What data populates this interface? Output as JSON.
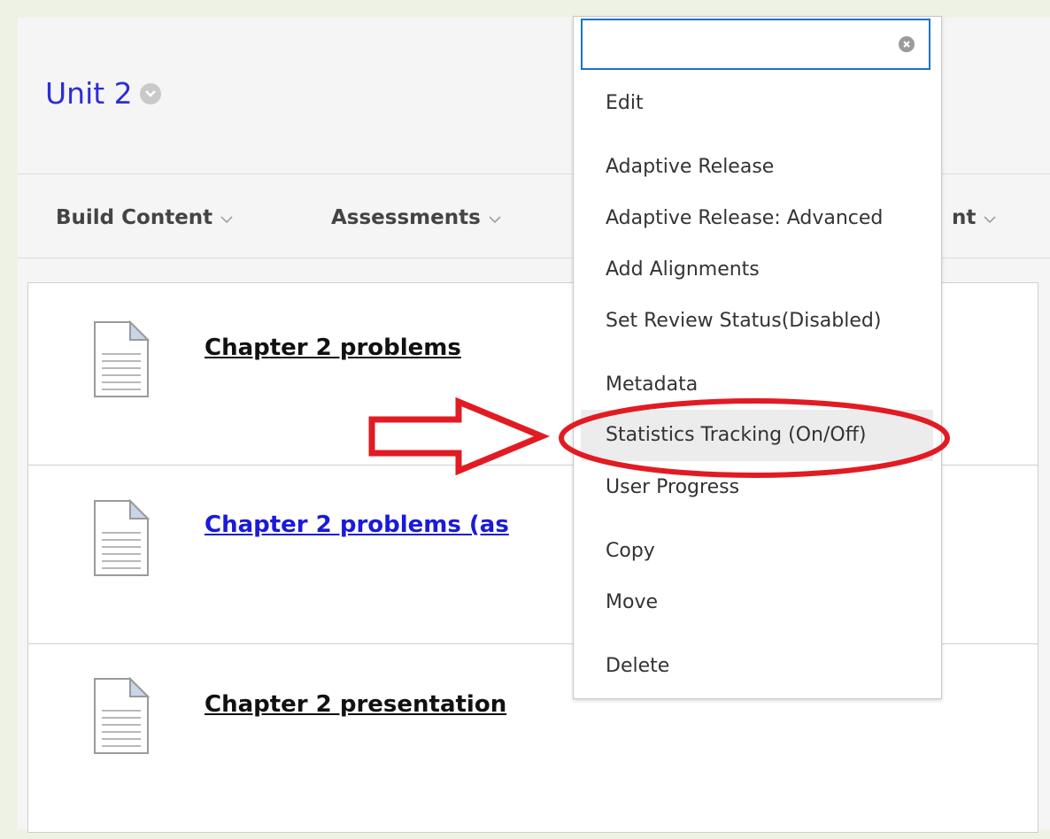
{
  "header": {
    "title": "Unit 2"
  },
  "toolbar": {
    "items": [
      {
        "label": "Build Content"
      },
      {
        "label": "Assessments"
      },
      {
        "label": "nt"
      }
    ]
  },
  "content": {
    "items": [
      {
        "title": "Chapter 2 problems",
        "color": "#111111"
      },
      {
        "title": "Chapter 2 problems (as",
        "color": "#1a1adb"
      },
      {
        "title": "Chapter 2 presentation",
        "color": "#111111"
      }
    ]
  },
  "menu": {
    "search": {
      "value": "",
      "placeholder": ""
    },
    "items": [
      {
        "label": "Edit"
      },
      {
        "label": "Adaptive Release"
      },
      {
        "label": "Adaptive Release: Advanced"
      },
      {
        "label": "Add Alignments"
      },
      {
        "label": "Set Review Status(Disabled)"
      },
      {
        "label": "Metadata"
      },
      {
        "label": "Statistics Tracking (On/Off)"
      },
      {
        "label": "User Progress"
      },
      {
        "label": "Copy"
      },
      {
        "label": "Move"
      },
      {
        "label": "Delete"
      }
    ]
  },
  "annotation": {
    "color": "#e21b23"
  }
}
